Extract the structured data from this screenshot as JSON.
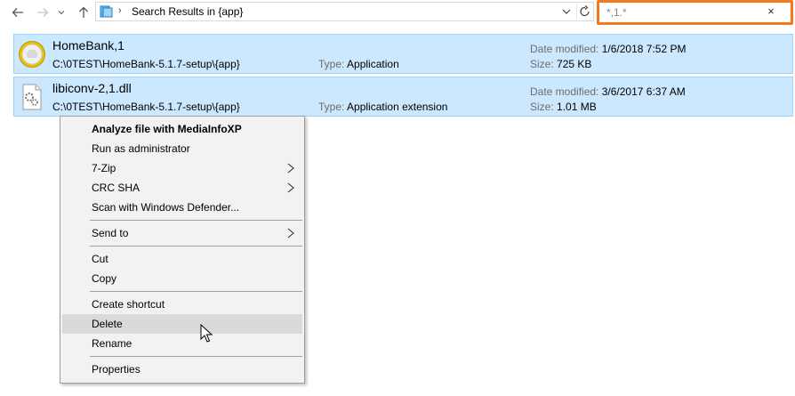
{
  "toolbar": {
    "back_icon": "arrow-left-icon",
    "forward_icon": "arrow-right-icon",
    "recent_icon": "chevron-down-icon",
    "up_icon": "arrow-up-icon"
  },
  "address": {
    "separator": "›",
    "path": "Search Results in {app}"
  },
  "search": {
    "value": "*,1.*",
    "clear": "×"
  },
  "results": [
    {
      "name": "HomeBank,1",
      "path": "C:\\0TEST\\HomeBank-5.1.7-setup\\{app}",
      "type_label": "Type:",
      "type_value": "Application",
      "date_label": "Date modified:",
      "date_value": "1/6/2018 7:52 PM",
      "size_label": "Size:",
      "size_value": "725 KB",
      "icon": "homebank-app-icon"
    },
    {
      "name": "libiconv-2,1.dll",
      "path": "C:\\0TEST\\HomeBank-5.1.7-setup\\{app}",
      "type_label": "Type:",
      "type_value": "Application extension",
      "date_label": "Date modified:",
      "date_value": "3/6/2017 6:37 AM",
      "size_label": "Size:",
      "size_value": "1.01 MB",
      "icon": "dll-file-icon"
    }
  ],
  "context_menu": {
    "items": [
      {
        "label": "Analyze file with MediaInfoXP",
        "bold": true
      },
      {
        "label": "Run as administrator"
      },
      {
        "label": "7-Zip",
        "submenu": true
      },
      {
        "label": "CRC SHA",
        "submenu": true
      },
      {
        "label": "Scan with Windows Defender..."
      },
      {
        "label": "Send to",
        "submenu": true
      },
      {
        "label": "Cut"
      },
      {
        "label": "Copy"
      },
      {
        "label": "Create shortcut"
      },
      {
        "label": "Delete",
        "highlighted": true
      },
      {
        "label": "Rename"
      },
      {
        "label": "Properties"
      }
    ]
  },
  "colors": {
    "selection_bg": "#cce8ff",
    "selection_border": "#99d1ff",
    "search_highlight": "#f5781e",
    "menu_bg": "#f2f2f2"
  }
}
